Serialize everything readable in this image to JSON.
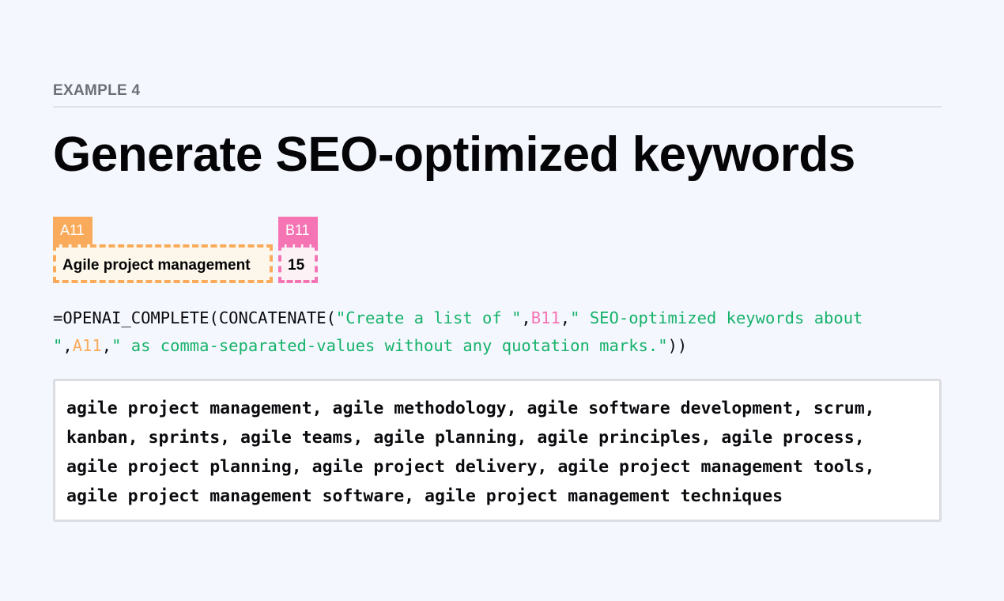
{
  "section_label": "EXAMPLE 4",
  "title": "Generate SEO-optimized keywords",
  "cells": {
    "a": {
      "ref": "A11",
      "value": "Agile project management",
      "color": "#f9ab5b"
    },
    "b": {
      "ref": "B11",
      "value": "15",
      "color": "#f474b4"
    }
  },
  "formula": {
    "line1": {
      "prefix": "=OPENAI_COMPLETE(CONCATENATE(",
      "str1": "\"Create a list of \"",
      "sep1": ",",
      "ref_b": "B11",
      "sep2": ",",
      "str2": "\" SEO-optimized keywords about"
    },
    "line2": {
      "str3": "\"",
      "sep3": ",",
      "ref_a": "A11",
      "sep4": ",",
      "str4": "\" as comma-separated-values without any quotation marks.\"",
      "suffix": "))"
    },
    "string_color": "#16b26a"
  },
  "result": {
    "lines": [
      "agile project management, agile methodology, agile software development, scrum,",
      "kanban, sprints, agile teams, agile planning, agile principles, agile process,",
      "agile project planning, agile project delivery, agile project management tools,",
      "agile project management software, agile project management techniques"
    ]
  }
}
